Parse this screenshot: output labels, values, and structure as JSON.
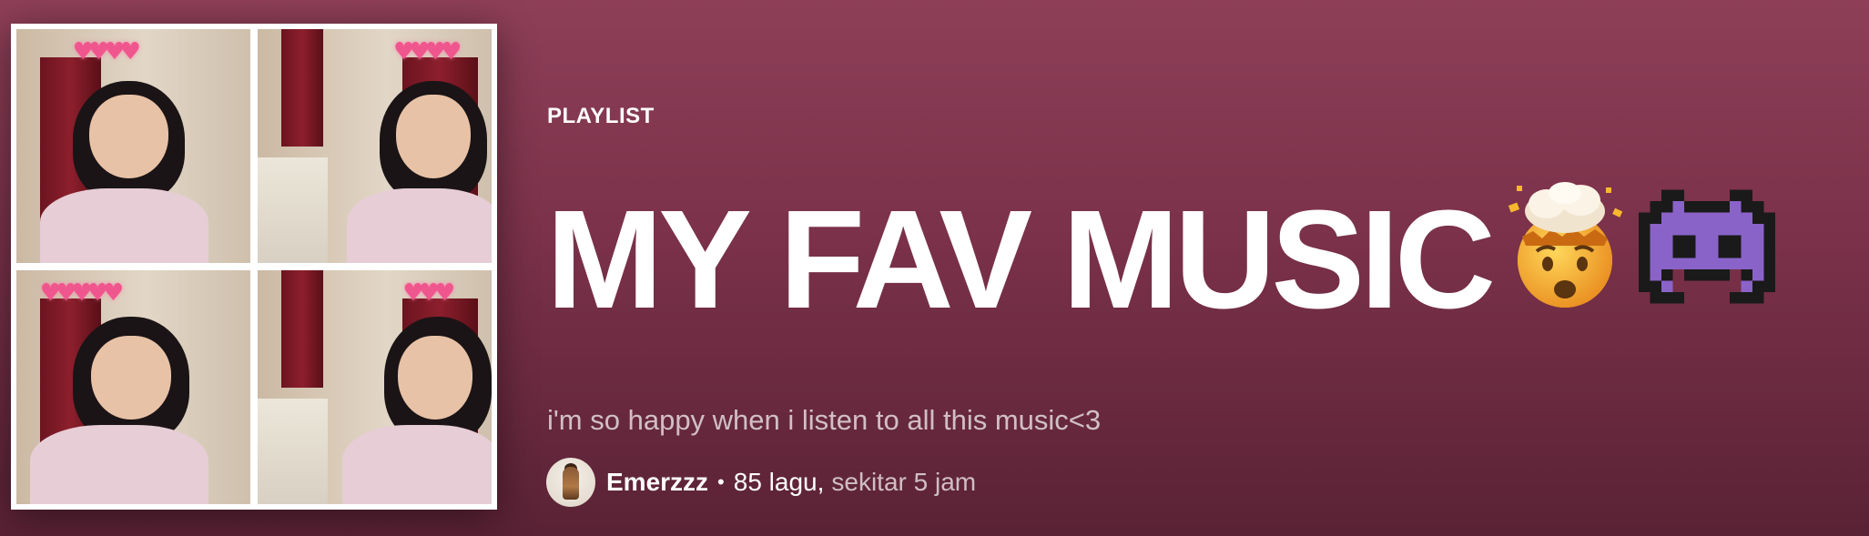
{
  "playlist": {
    "type_label": "PLAYLIST",
    "title": "MY FAV MUSIC",
    "title_emojis": [
      "exploding-head-emoji",
      "alien-monster-emoji"
    ],
    "description": "i'm so happy when i listen to all this music<3",
    "owner": "Emerzzz",
    "separator": "•",
    "song_count": "85 lagu,",
    "duration": "sekitar 5 jam"
  },
  "colors": {
    "background_top": "#8e3f58",
    "background_bottom": "#5a2235",
    "text_primary": "#ffffff",
    "text_secondary": "rgba(255,255,255,0.7)"
  }
}
